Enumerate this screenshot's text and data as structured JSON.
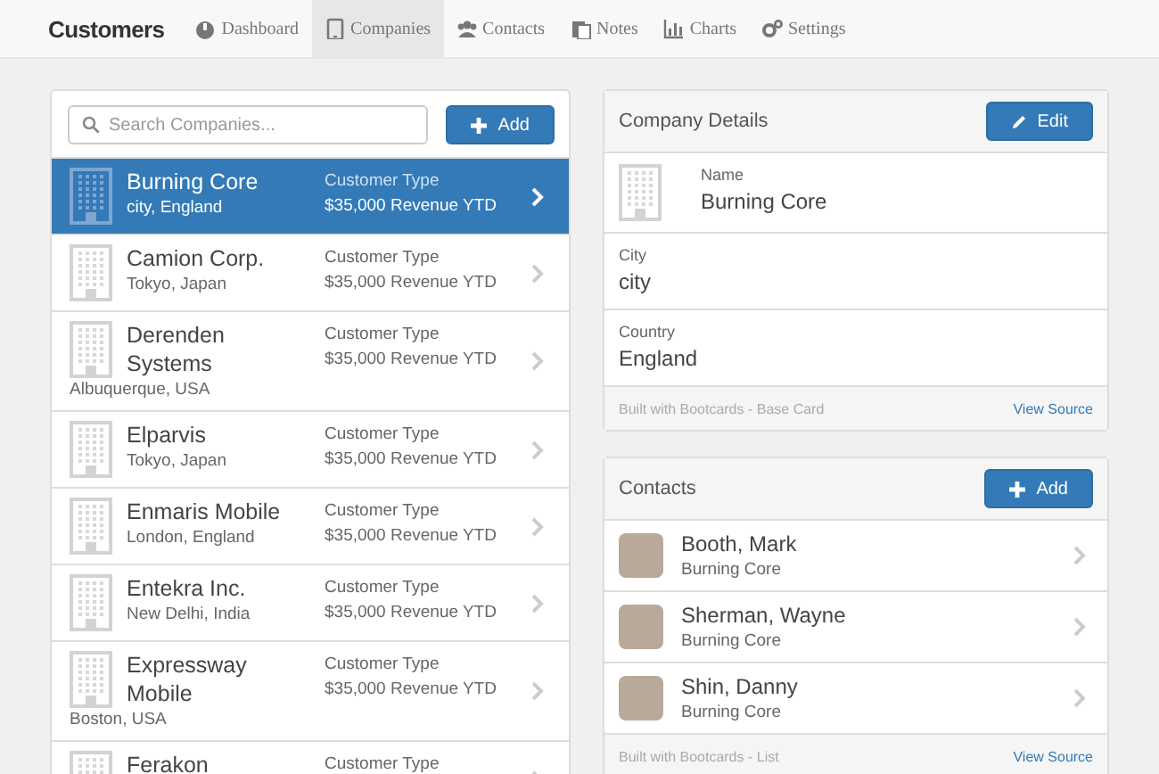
{
  "nav": {
    "brand": "Customers",
    "tabs": [
      {
        "label": "Dashboard",
        "selected": false
      },
      {
        "label": "Companies",
        "selected": true
      },
      {
        "label": "Contacts",
        "selected": false
      },
      {
        "label": "Notes",
        "selected": false
      },
      {
        "label": "Charts",
        "selected": false
      },
      {
        "label": "Settings",
        "selected": false
      }
    ]
  },
  "companies": {
    "search": {
      "placeholder": "Search Companies..."
    },
    "add_button": "Add",
    "items": [
      {
        "name": "Burning Core",
        "location": "city, England",
        "type": "Customer Type",
        "revenue": "$35,000 Revenue YTD",
        "selected": true
      },
      {
        "name": "Camion Corp.",
        "location": "Tokyo, Japan",
        "type": "Customer Type",
        "revenue": "$35,000 Revenue YTD",
        "selected": false
      },
      {
        "name": "Derenden Systems",
        "location": "Albuquerque, USA",
        "type": "Customer Type",
        "revenue": "$35,000 Revenue YTD",
        "selected": false
      },
      {
        "name": "Elparvis",
        "location": "Tokyo, Japan",
        "type": "Customer Type",
        "revenue": "$35,000 Revenue YTD",
        "selected": false
      },
      {
        "name": "Enmaris Mobile",
        "location": "London, England",
        "type": "Customer Type",
        "revenue": "$35,000 Revenue YTD",
        "selected": false
      },
      {
        "name": "Entekra Inc.",
        "location": "New Delhi, India",
        "type": "Customer Type",
        "revenue": "$35,000 Revenue YTD",
        "selected": false
      },
      {
        "name": "Expressway Mobile",
        "location": "Boston, USA",
        "type": "Customer Type",
        "revenue": "$35,000 Revenue YTD",
        "selected": false
      },
      {
        "name": "Ferakon",
        "type": "Customer Type",
        "selected": false
      }
    ]
  },
  "company_details": {
    "title": "Company Details",
    "edit_button": "Edit",
    "fields": [
      {
        "label": "Name",
        "value": "Burning Core"
      },
      {
        "label": "City",
        "value": "city"
      },
      {
        "label": "Country",
        "value": "England"
      }
    ],
    "footer": {
      "note": "Built with Bootcards - Base Card",
      "link": "View Source"
    }
  },
  "contacts": {
    "title": "Contacts",
    "add_button": "Add",
    "items": [
      {
        "name": "Booth, Mark",
        "company": "Burning Core"
      },
      {
        "name": "Sherman, Wayne",
        "company": "Burning Core"
      },
      {
        "name": "Shin, Danny",
        "company": "Burning Core"
      }
    ],
    "footer": {
      "note": "Built with Bootcards - List",
      "link": "View Source"
    }
  }
}
